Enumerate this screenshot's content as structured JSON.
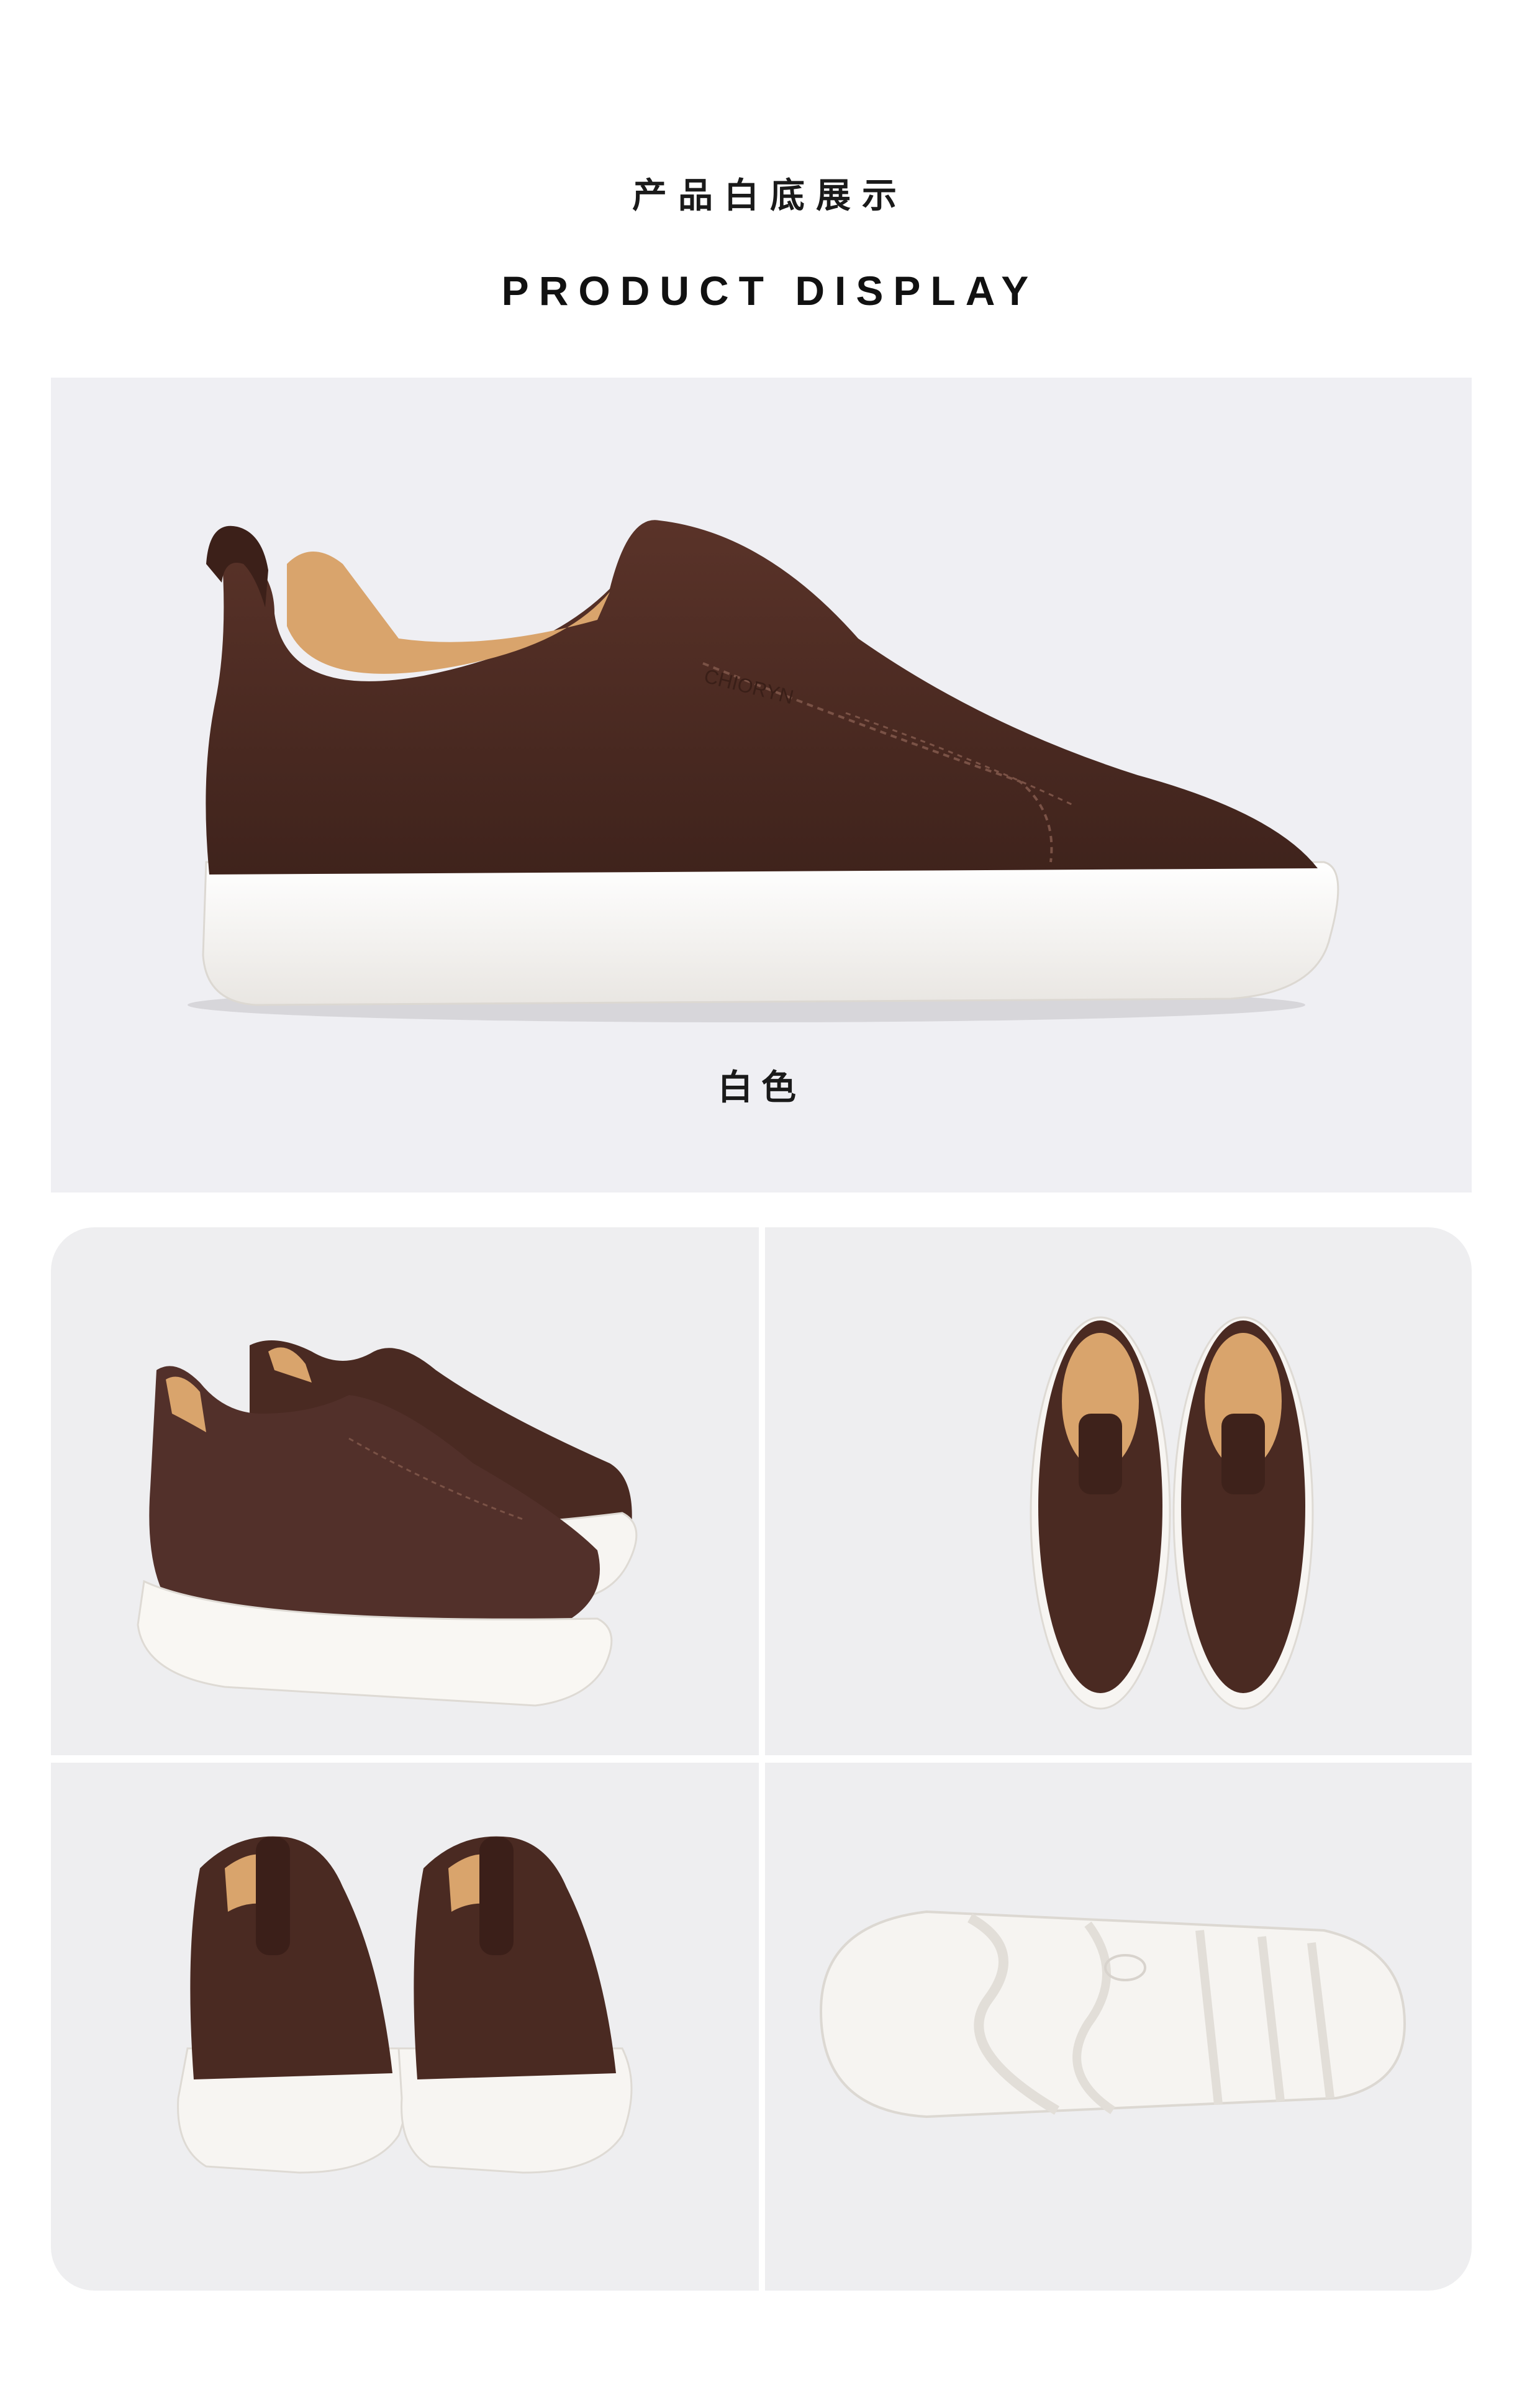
{
  "header": {
    "title_cn": "产品白底展示",
    "title_en": "PRODUCT DISPLAY"
  },
  "hero": {
    "color_label": "白色",
    "image": "brown-suede-slip-on-sneaker-side-view",
    "brand_mark": "CHIORYN"
  },
  "gallery": [
    {
      "image": "pair-three-quarter-view"
    },
    {
      "image": "pair-top-view"
    },
    {
      "image": "pair-back-view"
    },
    {
      "image": "outsole-bottom-view"
    }
  ],
  "colors": {
    "suede": "#4a2a22",
    "sole": "#f7f5f2",
    "lining": "#d9a46c",
    "hero_bg": "#efeff3",
    "cell_bg": "#eeeef0"
  }
}
